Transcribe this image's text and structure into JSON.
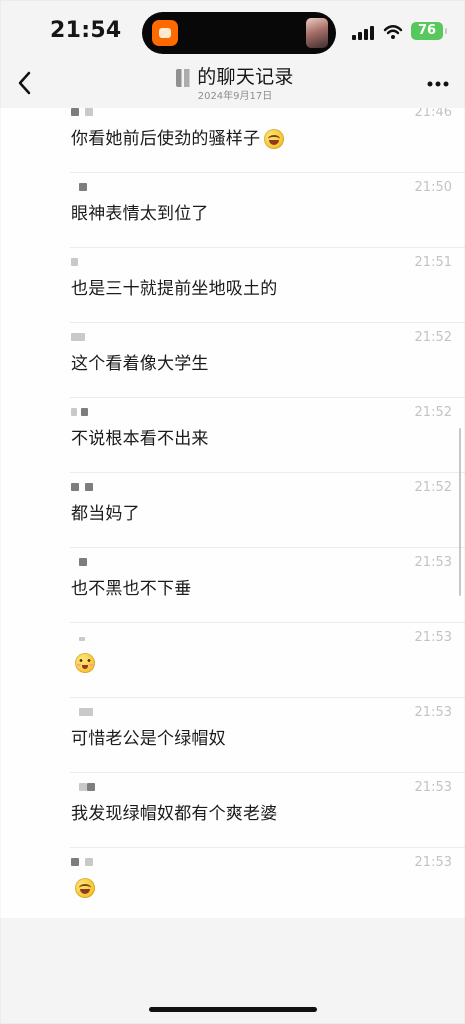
{
  "status_bar": {
    "time": "21:54",
    "battery": "76"
  },
  "header": {
    "title": "的聊天记录",
    "subtitle": "2024年9月17日"
  },
  "messages": [
    {
      "time": "21:46",
      "text": "你看她前后使劲的骚样子",
      "emoji": "laugh-emoji-icon"
    },
    {
      "time": "21:50",
      "text": "眼神表情太到位了"
    },
    {
      "time": "21:51",
      "text": "也是三十就提前坐地吸土的"
    },
    {
      "time": "21:52",
      "text": "这个看着像大学生"
    },
    {
      "time": "21:52",
      "text": "不说根本看不出来"
    },
    {
      "time": "21:52",
      "text": "都当妈了"
    },
    {
      "time": "21:53",
      "text": "也不黑也不下垂"
    },
    {
      "time": "21:53",
      "text": "",
      "emoji": "blush-emoji-icon"
    },
    {
      "time": "21:53",
      "text": "可惜老公是个绿帽奴"
    },
    {
      "time": "21:53",
      "text": "我发现绿帽奴都有个爽老婆"
    },
    {
      "time": "21:53",
      "text": "",
      "emoji": "laugh-emoji-icon"
    }
  ],
  "icons": {
    "back": "back-chevron-icon",
    "more": "more-dots-icon",
    "signal": "signal-icon",
    "wifi": "wifi-icon",
    "battery": "battery-icon"
  },
  "colors": {
    "background": "#f4f4f4",
    "chat_background": "#fefefe",
    "time_gray": "#c3c3c3",
    "battery_green": "#58c85d"
  }
}
